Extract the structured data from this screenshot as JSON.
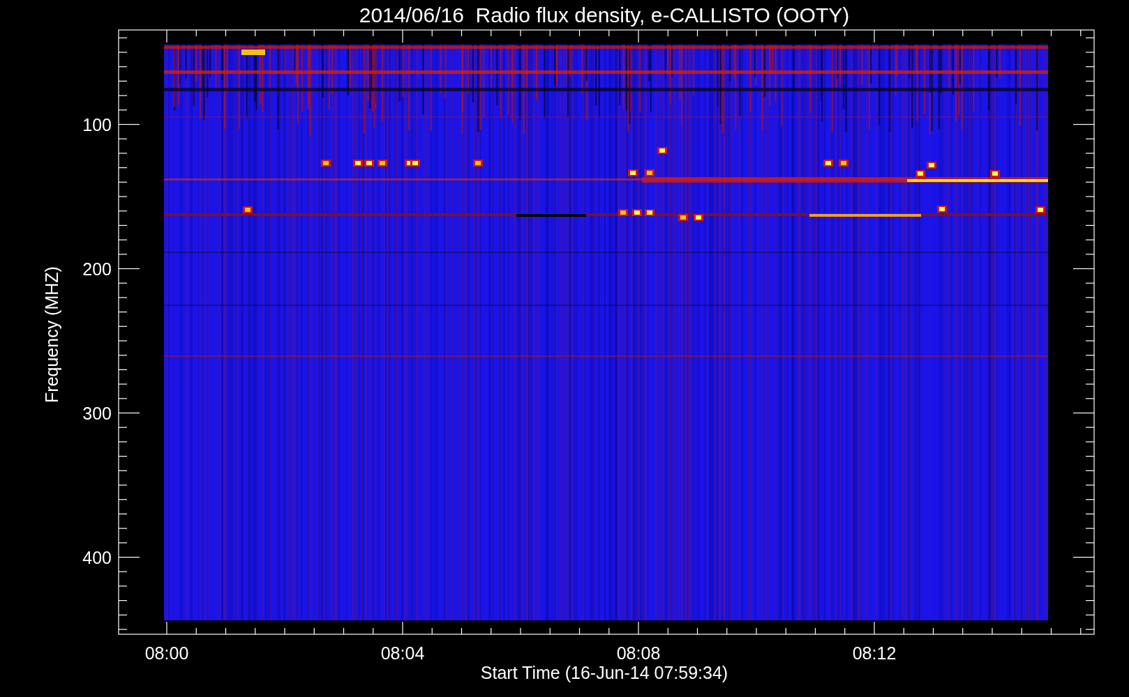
{
  "plot": {
    "title": "2014/06/16  Radio flux density, e-CALLISTO (OOTY)",
    "xlabel": "Start Time (16-Jun-14 07:59:34)",
    "ylabel": "Frequency (MHZ)",
    "x_tick_labels": [
      "08:00",
      "08:04",
      "08:08",
      "08:12"
    ],
    "y_tick_labels": [
      "100",
      "200",
      "300",
      "400"
    ]
  }
}
